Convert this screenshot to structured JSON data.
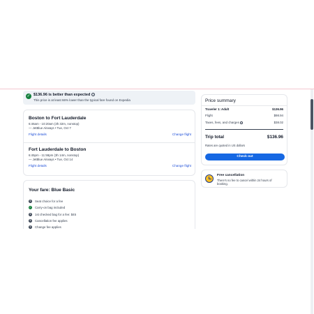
{
  "banner": {
    "title": "$136.96 is better than expected",
    "subtitle": "This price is at least 66% lower than the typical fare found on Expedia",
    "icon": "checkmark-icon"
  },
  "flights": [
    {
      "route": "Boston to Fort Lauderdale",
      "times": "6:46am - 10:20am (3h 32m, nonstop)",
      "airline": "JetBlue Airways • Tue, Oct 7",
      "details_label": "Flight details",
      "change_label": "Change flight"
    },
    {
      "route": "Fort Lauderdale to Boston",
      "times": "6:45pm - 11:59pm (3h 14m, nonstop)",
      "airline": "JetBlue Airways • Tue, Oct 14",
      "details_label": "Flight details",
      "change_label": "Change flight"
    }
  ],
  "fare": {
    "title": "Your fare: Blue Basic",
    "features": [
      {
        "text": "Seat choice for a fee",
        "icon": "dollar-icon",
        "status": "neutral"
      },
      {
        "text": "Carry-on bag included",
        "icon": "check-icon",
        "status": "green"
      },
      {
        "text": "1st checked bag for a fee: $45",
        "icon": "dollar-icon",
        "status": "neutral"
      },
      {
        "text": "Cancellation fee applies",
        "icon": "dollar-icon",
        "status": "neutral"
      },
      {
        "text": "Change fee applies",
        "icon": "dollar-icon",
        "status": "neutral"
      }
    ]
  },
  "summary": {
    "title": "Price summary",
    "traveler_label": "Traveler 1: Adult",
    "traveler_value": "$136.96",
    "flight_label": "Flight",
    "flight_value": "$98.94",
    "taxes_label": "Taxes, fees, and charges",
    "taxes_value": "$38.02",
    "total_label": "Trip total",
    "total_value": "$136.96",
    "rates_note": "Rates are quoted in US dollars",
    "checkout_label": "Check out"
  },
  "cancellation": {
    "title": "Free cancellation",
    "subtitle": "There's no fee to cancel within 24 hours of booking."
  },
  "colors": {
    "accent": "#1668e3",
    "link": "#1d4ed8",
    "success": "#15803d",
    "banner_bg": "#eef2f6",
    "clock": "#fbbf24"
  }
}
